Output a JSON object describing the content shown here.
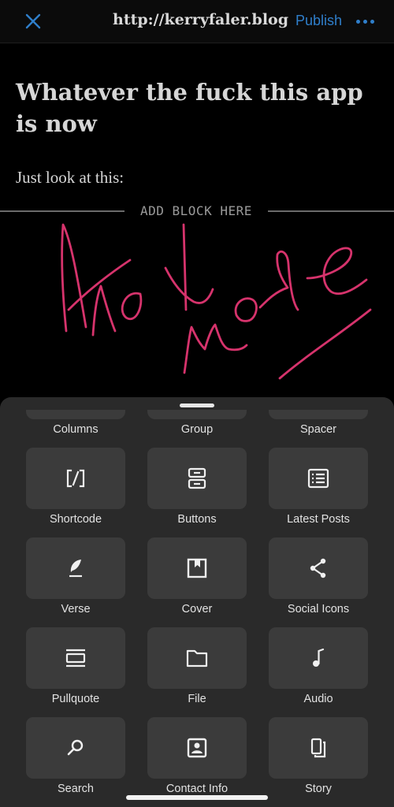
{
  "header": {
    "close_icon": "close-icon",
    "site_url": "http://kerryfaler.blog",
    "publish_label": "Publish",
    "more_icon": "more-horizontal-icon",
    "accent_color": "#2f7fcb"
  },
  "editor": {
    "title": "Whatever the fuck this app is now",
    "paragraph": "Just look at this:",
    "add_block_label": "ADD BLOCK HERE",
    "handwriting": "And more",
    "handwriting_color": "#d6336c"
  },
  "inserter": {
    "top_row": [
      {
        "label": "Columns"
      },
      {
        "label": "Group"
      },
      {
        "label": "Spacer"
      }
    ],
    "blocks": [
      {
        "label": "Shortcode",
        "icon": "shortcode-icon"
      },
      {
        "label": "Buttons",
        "icon": "buttons-icon"
      },
      {
        "label": "Latest Posts",
        "icon": "latest-posts-icon"
      },
      {
        "label": "Verse",
        "icon": "quill-icon"
      },
      {
        "label": "Cover",
        "icon": "cover-icon"
      },
      {
        "label": "Social Icons",
        "icon": "share-icon"
      },
      {
        "label": "Pullquote",
        "icon": "pullquote-icon"
      },
      {
        "label": "File",
        "icon": "folder-icon"
      },
      {
        "label": "Audio",
        "icon": "music-note-icon"
      },
      {
        "label": "Search",
        "icon": "search-icon"
      },
      {
        "label": "Contact Info",
        "icon": "contact-card-icon"
      },
      {
        "label": "Story",
        "icon": "story-icon"
      }
    ]
  }
}
